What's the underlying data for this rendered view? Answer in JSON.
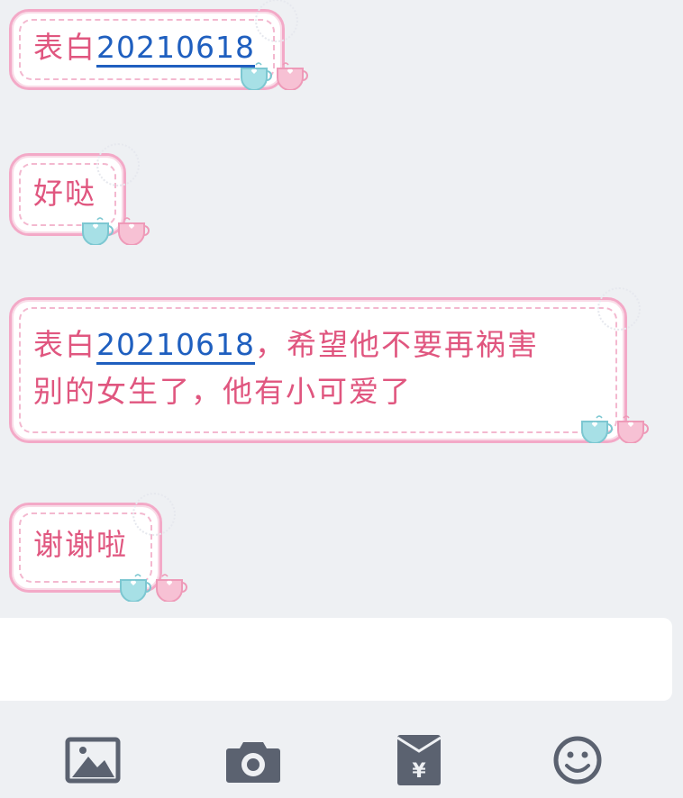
{
  "messages": [
    {
      "prefix": "表白",
      "link": "20210618",
      "suffix": ""
    },
    {
      "text": "好哒"
    },
    {
      "prefix": "表白",
      "link": "20210618",
      "line1_rest": "，希望他不要再祸害",
      "line2": "别的女生了，他有小可爱了"
    },
    {
      "text": "谢谢啦"
    }
  ],
  "input": {
    "value": ""
  },
  "toolbar": {
    "icons": [
      "image-icon",
      "camera-icon",
      "red-packet-icon",
      "emoji-icon"
    ]
  },
  "colors": {
    "text": "#e0567f",
    "link": "#1f5fbf",
    "bubble_border": "#f3a9c7",
    "background": "#eef0f3",
    "icon": "#5b6270"
  }
}
